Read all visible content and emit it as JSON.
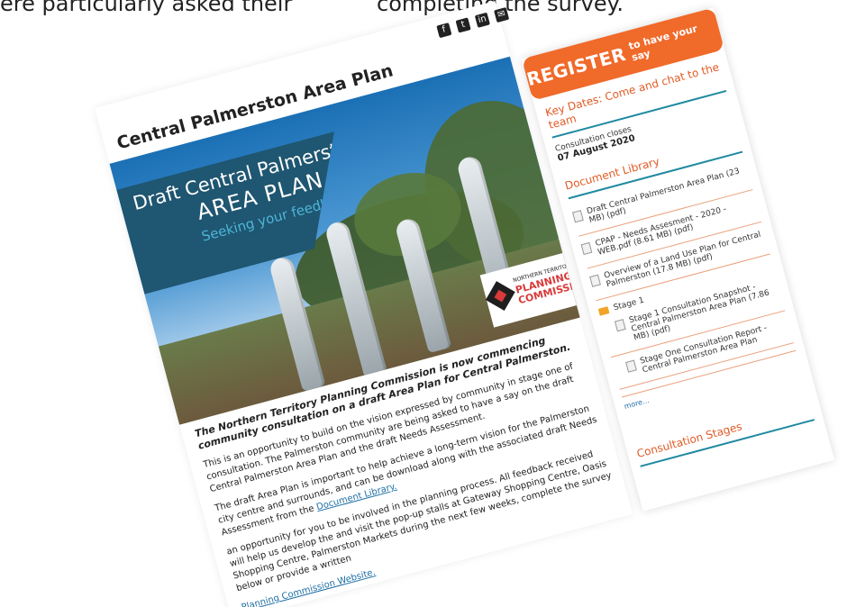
{
  "background_text": {
    "left": "ere particularly asked their",
    "right": "completing the survey."
  },
  "content": {
    "title": "Central Palmerston Area Plan",
    "social": [
      {
        "name": "facebook-icon",
        "glyph": "f"
      },
      {
        "name": "twitter-icon",
        "glyph": "t"
      },
      {
        "name": "linkedin-icon",
        "glyph": "in"
      },
      {
        "name": "email-icon",
        "glyph": "✉"
      }
    ],
    "banner": {
      "line1": "Draft Central Palmerston",
      "line2": "AREA PLAN",
      "line3": "Seeking your feedback"
    },
    "logo": {
      "small": "NORTHERN TERRITORY",
      "line1": "PLANNING",
      "line2": "COMMISSION"
    },
    "body": {
      "lead": "The Northern Territory Planning Commission is now commencing community consultation on a draft Area Plan for Central Palmerston.",
      "p1": "This is an opportunity to build on the vision expressed by community in stage one of consultation. The Palmerston community are being asked to have a say on the draft Central Palmerston Area Plan and the draft Needs Assessment.",
      "p2_text": "The draft Area Plan is important to help achieve a long-term vision for the Palmerston city centre and surrounds, and can be download along with the associated draft Needs Assessment from the",
      "p2_link": "Document Library.",
      "p3": "an opportunity for you to be involved in the planning process. All feedback received will help us develop the and visit the pop-up stalls at Gateway Shopping Centre, Oasis Shopping Centre, Palmerston Markets during the next few weeks, complete the survey below or provide a written",
      "p4_link": "Planning Commission Website."
    }
  },
  "sidebar": {
    "register": {
      "main": "REGISTER",
      "sub": "to have your say"
    },
    "key_dates": {
      "title": "Key Dates: Come and chat to the team",
      "label": "Consultation closes",
      "date": "07 August 2020"
    },
    "library": {
      "title": "Document Library",
      "documents": [
        "Draft Central Palmerston Area Plan (23 MB) (pdf)",
        "CPAP - Needs Assesment - 2020 - WEB.pdf (8.61 MB) (pdf)",
        "Overview of a Land Use Plan for Central Palmerston (17.8 MB) (pdf)"
      ],
      "folder": {
        "name": "Stage 1",
        "children": [
          "Stage 1 Consultation Snapshot -Central Palmerston Area Plan (7.86 MB) (pdf)",
          "Stage One Consultation Report - Central Palmerston Area Plan"
        ]
      },
      "more": "more..."
    },
    "consultation_stages": {
      "title": "Consultation Stages"
    }
  }
}
